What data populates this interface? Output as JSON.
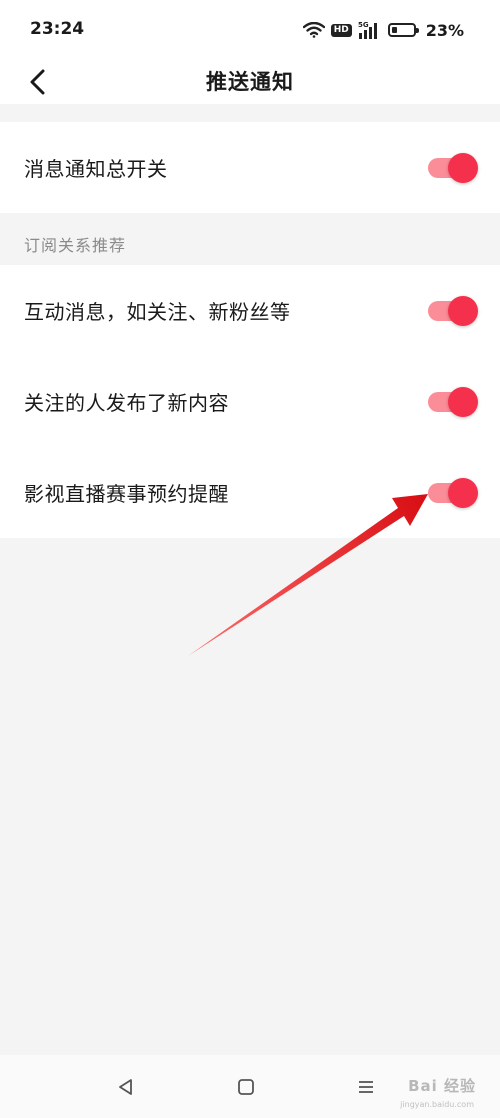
{
  "status_bar": {
    "time": "23:24",
    "hd_badge": "HD",
    "network": "5G",
    "battery_percent": 23,
    "battery_text": "23%",
    "icons": [
      "wifi-icon",
      "hd-icon",
      "signal-5g-icon",
      "battery-icon"
    ]
  },
  "nav": {
    "title": "推送通知",
    "back_icon": "chevron-left-icon"
  },
  "master_switch": {
    "label": "消息通知总开关",
    "enabled": true
  },
  "subscription_section": {
    "header": "订阅关系推荐",
    "items": [
      {
        "label": "互动消息，如关注、新粉丝等",
        "enabled": true
      },
      {
        "label": "关注的人发布了新内容",
        "enabled": true
      },
      {
        "label": "影视直播赛事预约提醒",
        "enabled": true
      }
    ]
  },
  "system_nav": {
    "icons": [
      "triangle-back-icon",
      "square-home-icon",
      "menu-lines-icon"
    ]
  },
  "watermark": {
    "text": "Bai 经验",
    "sub": "jingyan.baidu.com"
  },
  "colors": {
    "toggle_on_knob": "#f5304d",
    "toggle_on_track": "#fb8d98",
    "annotation_arrow": "#e3161e",
    "background": "#f4f4f4"
  }
}
